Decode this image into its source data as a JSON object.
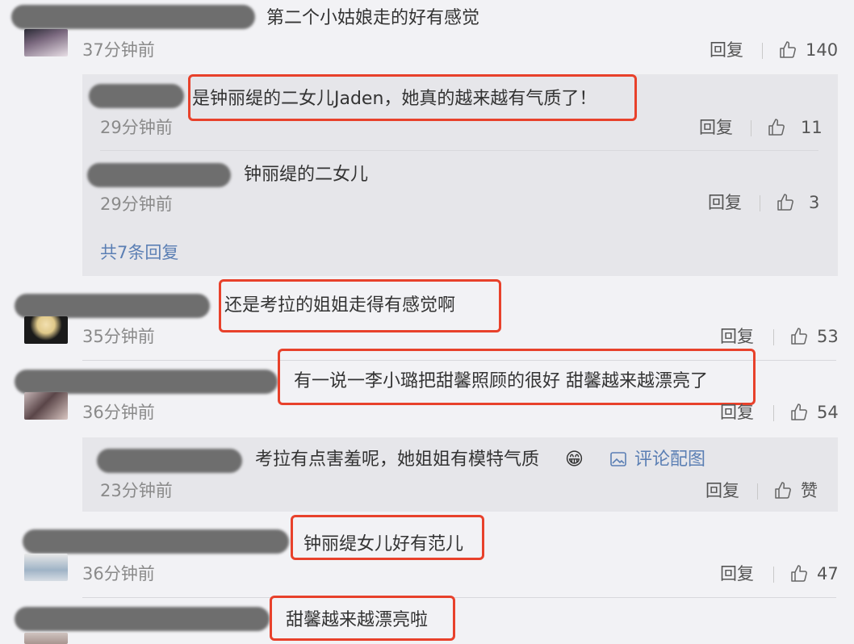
{
  "comments": [
    {
      "text": "第二个小姑娘走的好有感觉",
      "time": "37分钟前",
      "reply": "回复",
      "likes": "140"
    },
    {
      "text": "还是考拉的姐姐走得有感觉啊",
      "time": "35分钟前",
      "reply": "回复",
      "likes": "53"
    },
    {
      "text": "有一说一李小璐把甜馨照顾的很好 甜馨越来越漂亮了",
      "time": "36分钟前",
      "reply": "回复",
      "likes": "54"
    },
    {
      "text": "钟丽缇女儿好有范儿",
      "time": "36分钟前",
      "reply": "回复",
      "likes": "47"
    },
    {
      "text": "甜馨越来越漂亮啦"
    }
  ],
  "replies_block_1": [
    {
      "text": "是钟丽缇的二女儿Jaden，她真的越来越有气质了！",
      "time": "29分钟前",
      "reply": "回复",
      "likes": "11"
    },
    {
      "text": "钟丽缇的二女儿",
      "time": "29分钟前",
      "reply": "回复",
      "likes": "3"
    }
  ],
  "more_replies": "共7条回复",
  "reply_block_3": {
    "text": "考拉有点害羞呢，她姐姐有模特气质",
    "emoji": "😁",
    "image_link": "评论配图",
    "time": "23分钟前",
    "reply": "回复",
    "likes": "赞"
  },
  "colors": {
    "background": "#f2f2f5",
    "reply_bg": "#e6e6ea",
    "highlight": "#e8412b",
    "link": "#5b7fb4"
  }
}
